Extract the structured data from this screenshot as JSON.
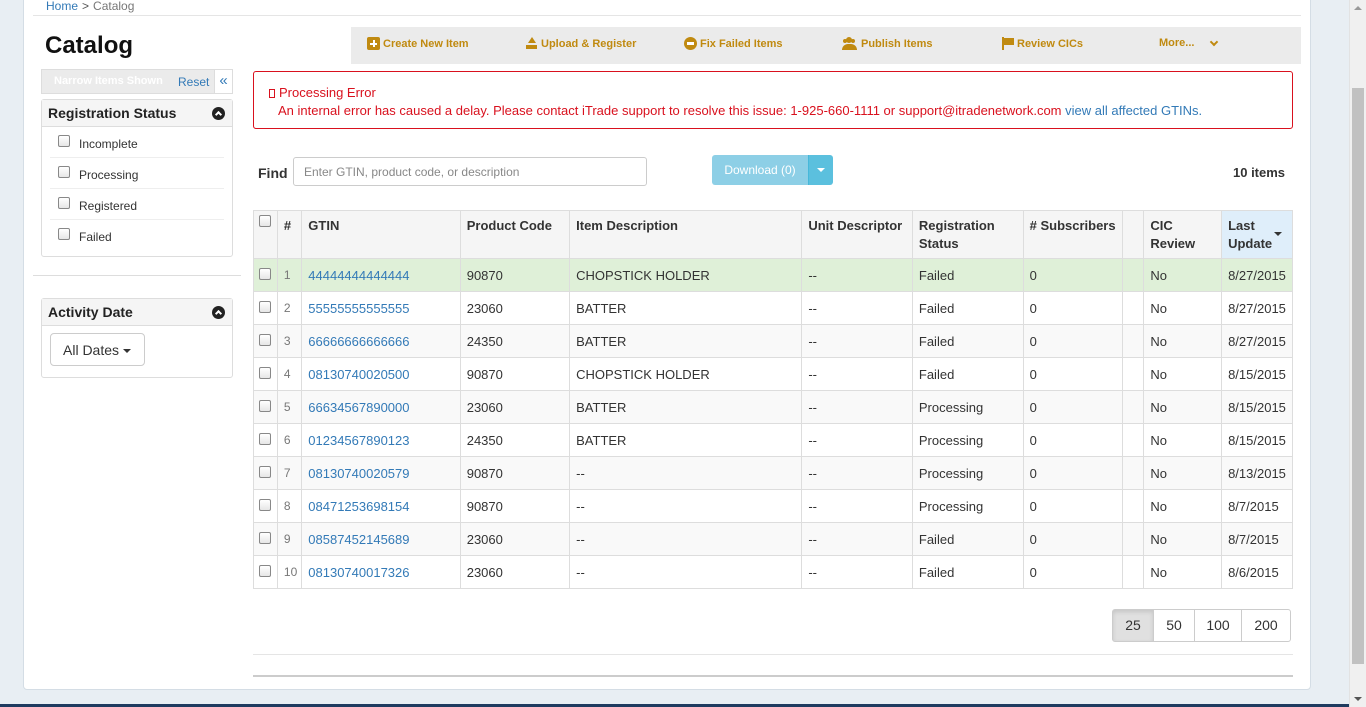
{
  "breadcrumb": {
    "home": "Home",
    "separator": ">",
    "current": "Catalog"
  },
  "page_title": "Catalog",
  "toolbar": {
    "create": "Create New Item",
    "upload": "Upload & Register",
    "fix": "Fix Failed Items",
    "publish": "Publish Items",
    "review": "Review CICs",
    "more": "More...",
    "accent_color": "#c08a10"
  },
  "filters": {
    "narrow_label": "Narrow Items Shown",
    "reset": "Reset",
    "collapse": "«",
    "registration_status": {
      "title": "Registration Status",
      "options": [
        "Incomplete",
        "Processing",
        "Registered",
        "Failed"
      ]
    },
    "activity_date": {
      "title": "Activity Date",
      "selected": "All Dates"
    }
  },
  "error": {
    "title": "Processing Error",
    "message": "An internal error has caused a delay. Please contact iTrade support to resolve this issue: 1-925-660-1111 or support@itradenetwork.com",
    "link": "view all affected GTINs.",
    "color": "#d9111e"
  },
  "find": {
    "label": "Find",
    "placeholder": "Enter GTIN, product code, or description",
    "download": "Download (0)",
    "count": "10 items"
  },
  "table": {
    "headers": [
      "#",
      "GTIN",
      "Product Code",
      "Item Description",
      "Unit Descriptor",
      "Registration Status",
      "# Subscribers",
      "",
      "CIC Review",
      "Last Update"
    ],
    "rows": [
      {
        "n": "1",
        "gtin": "44444444444444",
        "code": "90870",
        "desc": "CHOPSTICK HOLDER",
        "unit": "--",
        "status": "Failed",
        "subs": "0",
        "cic": "No",
        "date": "8/27/2015"
      },
      {
        "n": "2",
        "gtin": "55555555555555",
        "code": "23060",
        "desc": "BATTER",
        "unit": "--",
        "status": "Failed",
        "subs": "0",
        "cic": "No",
        "date": "8/27/2015"
      },
      {
        "n": "3",
        "gtin": "66666666666666",
        "code": "24350",
        "desc": "BATTER",
        "unit": "--",
        "status": "Failed",
        "subs": "0",
        "cic": "No",
        "date": "8/27/2015"
      },
      {
        "n": "4",
        "gtin": "08130740020500",
        "code": "90870",
        "desc": "CHOPSTICK HOLDER",
        "unit": "--",
        "status": "Failed",
        "subs": "0",
        "cic": "No",
        "date": "8/15/2015"
      },
      {
        "n": "5",
        "gtin": "66634567890000",
        "code": "23060",
        "desc": "BATTER",
        "unit": "--",
        "status": "Processing",
        "subs": "0",
        "cic": "No",
        "date": "8/15/2015"
      },
      {
        "n": "6",
        "gtin": "01234567890123",
        "code": "24350",
        "desc": "BATTER",
        "unit": "--",
        "status": "Processing",
        "subs": "0",
        "cic": "No",
        "date": "8/15/2015"
      },
      {
        "n": "7",
        "gtin": "08130740020579",
        "code": "90870",
        "desc": "--",
        "unit": "--",
        "status": "Processing",
        "subs": "0",
        "cic": "No",
        "date": "8/13/2015"
      },
      {
        "n": "8",
        "gtin": "08471253698154",
        "code": "90870",
        "desc": "--",
        "unit": "--",
        "status": "Processing",
        "subs": "0",
        "cic": "No",
        "date": "8/7/2015"
      },
      {
        "n": "9",
        "gtin": "08587452145689",
        "code": "23060",
        "desc": "--",
        "unit": "--",
        "status": "Failed",
        "subs": "0",
        "cic": "No",
        "date": "8/7/2015"
      },
      {
        "n": "10",
        "gtin": "08130740017326",
        "code": "23060",
        "desc": "--",
        "unit": "--",
        "status": "Failed",
        "subs": "0",
        "cic": "No",
        "date": "8/6/2015"
      }
    ],
    "highlight_color": "#dff0d8"
  },
  "pagination": {
    "sizes": [
      "25",
      "50",
      "100",
      "200"
    ],
    "selected": "25"
  }
}
